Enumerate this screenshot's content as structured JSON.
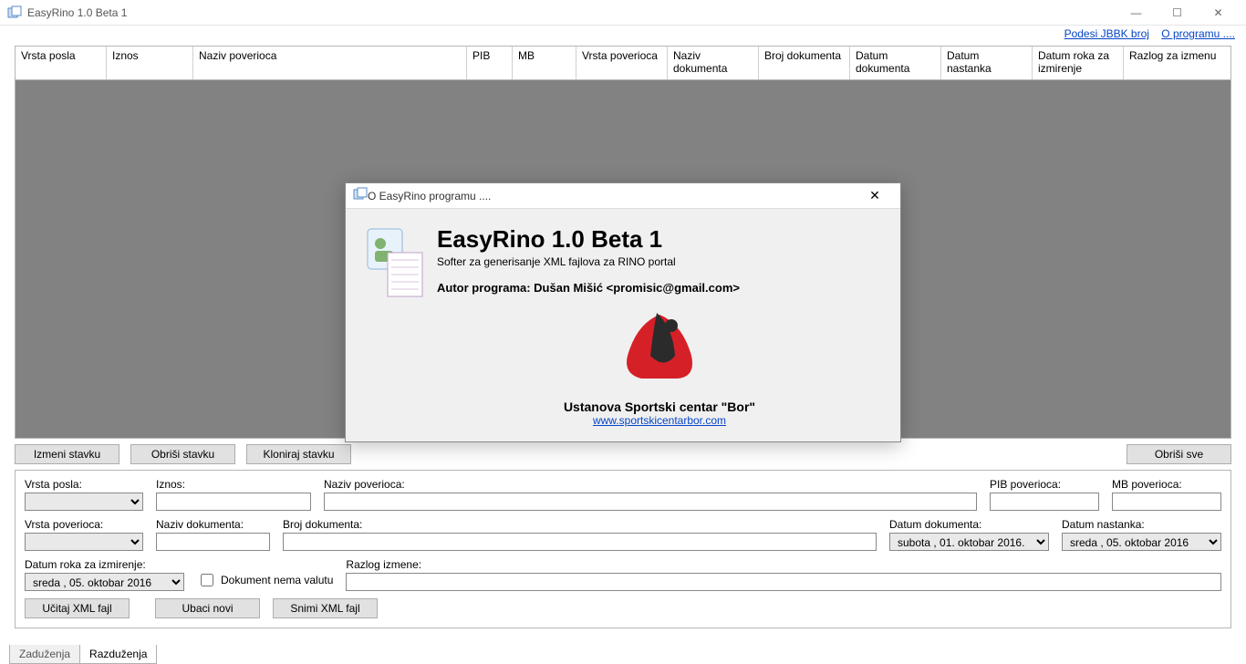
{
  "window": {
    "title": "EasyRino 1.0 Beta 1"
  },
  "links": {
    "jbbk": "Podesi JBBK broj",
    "about": "O programu ...."
  },
  "columns": {
    "c0": "Vrsta posla",
    "c1": "Iznos",
    "c2": "Naziv poverioca",
    "c3": "PIB",
    "c4": "MB",
    "c5": "Vrsta poverioca",
    "c6": "Naziv dokumenta",
    "c7": "Broj dokumenta",
    "c8": "Datum dokumenta",
    "c9": "Datum nastanka",
    "c10": "Datum roka za izmirenje",
    "c11": "Razlog za izmenu"
  },
  "buttons": {
    "izmeni": "Izmeni stavku",
    "obrisi": "Obriši stavku",
    "kloniraj": "Kloniraj stavku",
    "obrisve": "Obriši sve",
    "ucitaj": "Učitaj XML fajl",
    "ubaci": "Ubaci novi",
    "snimi": "Snimi XML fajl"
  },
  "form": {
    "vrsta_posla_l": "Vrsta posla:",
    "iznos_l": "Iznos:",
    "naziv_pov_l": "Naziv poverioca:",
    "pib_pov_l": "PIB poverioca:",
    "mb_pov_l": "MB poverioca:",
    "vrsta_pov_l": "Vrsta poverioca:",
    "naziv_dok_l": "Naziv dokumenta:",
    "broj_dok_l": "Broj dokumenta:",
    "datum_dok_l": "Datum dokumenta:",
    "datum_dok_v": "subota  , 01.  oktobar   2016.",
    "datum_nast_l": "Datum nastanka:",
    "datum_nast_v": "sreda   , 05.  oktobar   2016",
    "datum_rok_l": "Datum roka za izmirenje:",
    "datum_rok_v": "sreda   , 05.  oktobar   2016",
    "nema_valutu": "Dokument nema valutu",
    "razlog_l": "Razlog izmene:"
  },
  "tabs": {
    "zad": "Zaduženja",
    "raz": "Razduženja"
  },
  "dialog": {
    "title": "O EasyRino programu ....",
    "h1": "EasyRino 1.0 Beta 1",
    "sub": "Softer za generisanje XML fajlova za RINO portal",
    "author": "Autor programa: Dušan Mišić <promisic@gmail.com>",
    "org": "Ustanova Sportski centar \"Bor\"",
    "url": "www.sportskicentarbor.com"
  }
}
